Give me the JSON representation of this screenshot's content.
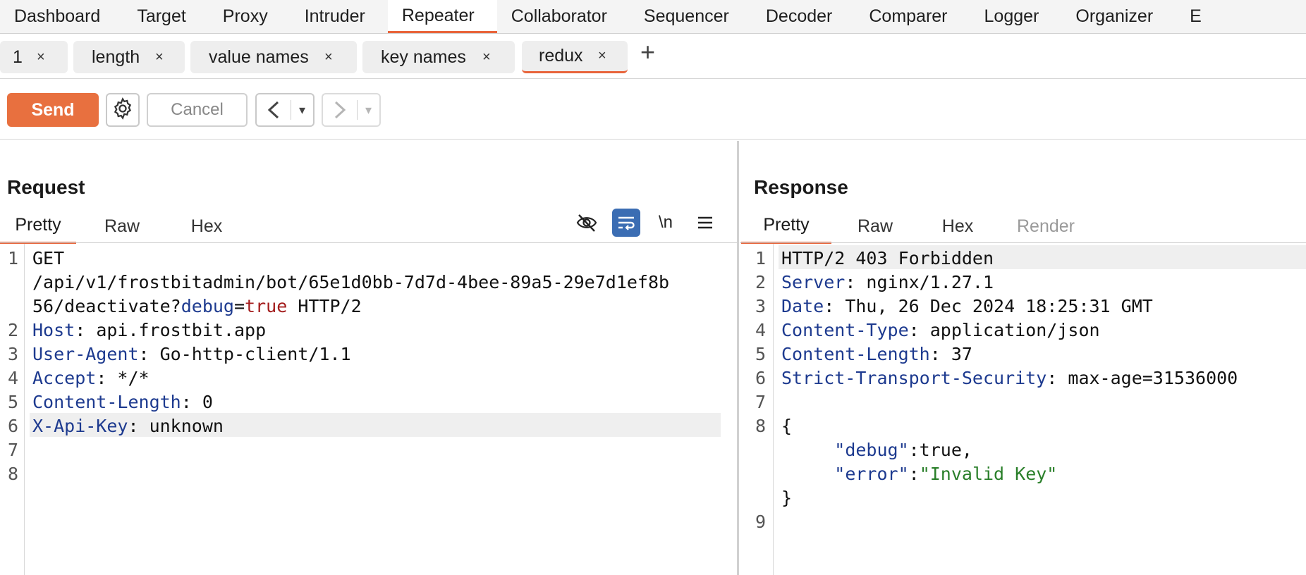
{
  "top_nav": {
    "items": [
      "Dashboard",
      "Target",
      "Proxy",
      "Intruder",
      "Repeater",
      "Collaborator",
      "Sequencer",
      "Decoder",
      "Comparer",
      "Logger",
      "Organizer",
      "E"
    ],
    "active": "Repeater"
  },
  "repeater_tabs": {
    "items": [
      "1",
      "length",
      "value names",
      "key names",
      "redux"
    ],
    "active": "redux",
    "close_glyph": "×",
    "add_glyph": "+"
  },
  "toolbar": {
    "send_label": "Send",
    "cancel_label": "Cancel",
    "gear_icon": "gear-icon",
    "back_glyph": "<",
    "forward_glyph": ">",
    "dropdown_glyph": "▾"
  },
  "request": {
    "title": "Request",
    "tabs": [
      "Pretty",
      "Raw",
      "Hex"
    ],
    "active_tab": "Pretty",
    "newline_toggle": "\\n",
    "lines": [
      {
        "n": "1",
        "segments": [
          {
            "t": "GET",
            "c": ""
          }
        ]
      },
      {
        "n": "",
        "segments": [
          {
            "t": "/api/v1/frostbitadmin/bot/65e1d0bb-7d7d-4bee-89a5-29e7d1ef8b",
            "c": ""
          }
        ]
      },
      {
        "n": "",
        "segments": [
          {
            "t": "56/deactivate?",
            "c": ""
          },
          {
            "t": "debug",
            "c": "pn"
          },
          {
            "t": "=",
            "c": ""
          },
          {
            "t": "true",
            "c": "pv"
          },
          {
            "t": " HTTP/2",
            "c": ""
          }
        ]
      },
      {
        "n": "2",
        "segments": [
          {
            "t": "Host",
            "c": "hn"
          },
          {
            "t": ": api.frostbit.app",
            "c": ""
          }
        ]
      },
      {
        "n": "3",
        "segments": [
          {
            "t": "User-Agent",
            "c": "hn"
          },
          {
            "t": ": Go-http-client/1.1",
            "c": ""
          }
        ]
      },
      {
        "n": "4",
        "segments": [
          {
            "t": "Accept",
            "c": "hn"
          },
          {
            "t": ": */*",
            "c": ""
          }
        ]
      },
      {
        "n": "5",
        "segments": [
          {
            "t": "Content-Length",
            "c": "hn"
          },
          {
            "t": ": 0",
            "c": ""
          }
        ]
      },
      {
        "n": "6",
        "segments": [
          {
            "t": "X-Api-Key",
            "c": "hn"
          },
          {
            "t": ": unknown",
            "c": ""
          }
        ],
        "highlight": true
      },
      {
        "n": "7",
        "segments": []
      },
      {
        "n": "8",
        "segments": []
      }
    ]
  },
  "response": {
    "title": "Response",
    "tabs": [
      "Pretty",
      "Raw",
      "Hex",
      "Render"
    ],
    "active_tab": "Pretty",
    "disabled_tab": "Render",
    "lines": [
      {
        "n": "1",
        "segments": [
          {
            "t": "HTTP/2 403 Forbidden",
            "c": ""
          }
        ],
        "highlight": true
      },
      {
        "n": "2",
        "segments": [
          {
            "t": "Server",
            "c": "hn"
          },
          {
            "t": ": nginx/1.27.1",
            "c": ""
          }
        ]
      },
      {
        "n": "3",
        "segments": [
          {
            "t": "Date",
            "c": "hn"
          },
          {
            "t": ": Thu, 26 Dec 2024 18:25:31 GMT",
            "c": ""
          }
        ]
      },
      {
        "n": "4",
        "segments": [
          {
            "t": "Content-Type",
            "c": "hn"
          },
          {
            "t": ": application/json",
            "c": ""
          }
        ]
      },
      {
        "n": "5",
        "segments": [
          {
            "t": "Content-Length",
            "c": "hn"
          },
          {
            "t": ": 37",
            "c": ""
          }
        ]
      },
      {
        "n": "6",
        "segments": [
          {
            "t": "Strict-Transport-Security",
            "c": "hn"
          },
          {
            "t": ": max-age=31536000",
            "c": ""
          }
        ]
      },
      {
        "n": "7",
        "segments": []
      },
      {
        "n": "8",
        "segments": [
          {
            "t": "{",
            "c": ""
          }
        ]
      },
      {
        "n": "",
        "segments": [
          {
            "t": "     ",
            "c": ""
          },
          {
            "t": "\"debug\"",
            "c": "jk"
          },
          {
            "t": ":true,",
            "c": ""
          }
        ]
      },
      {
        "n": "",
        "segments": [
          {
            "t": "     ",
            "c": ""
          },
          {
            "t": "\"error\"",
            "c": "jk"
          },
          {
            "t": ":",
            "c": ""
          },
          {
            "t": "\"Invalid Key\"",
            "c": "js"
          }
        ]
      },
      {
        "n": "",
        "segments": [
          {
            "t": "}",
            "c": ""
          }
        ]
      },
      {
        "n": "9",
        "segments": []
      }
    ]
  },
  "colors": {
    "accent": "#e8643a",
    "send_button": "#e8703f",
    "header_name": "#1d3a8f",
    "param_value": "#a31d1d",
    "json_string": "#2a7f2a",
    "wrap_toggle": "#3b6db3"
  }
}
